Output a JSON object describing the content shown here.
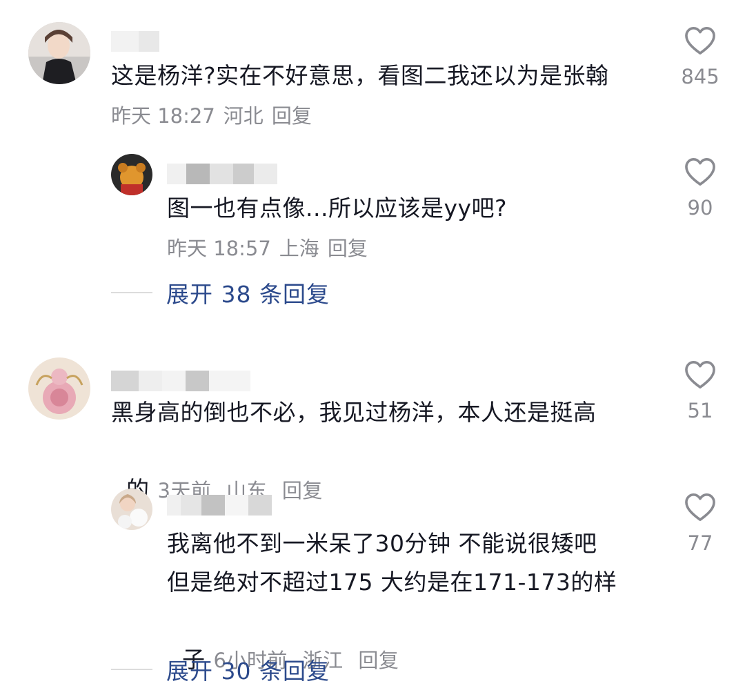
{
  "comments": [
    {
      "text": "这是杨洋?实在不好意思，看图二我还以为是张翰",
      "time": "昨天 18:27",
      "location": "河北",
      "reply": "回复",
      "likes": "845",
      "replies": [
        {
          "text": "图一也有点像...所以应该是yy吧?",
          "time": "昨天 18:57",
          "location": "上海",
          "reply": "回复",
          "likes": "90"
        }
      ],
      "expand_label": "展开 38 条回复"
    },
    {
      "text": "黑身高的倒也不必，我见过杨洋，本人还是挺高",
      "text_tail": "的",
      "time": "3天前",
      "location": "山东",
      "reply": "回复",
      "likes": "51",
      "replies": [
        {
          "text_line1": "我离他不到一米呆了30分钟 不能说很矮吧",
          "text_line2": "但是绝对不超过175 大约是在171-173的样",
          "text_tail": "子",
          "time": "6小时前",
          "location": "浙江",
          "reply": "回复",
          "likes": "77"
        }
      ],
      "expand_label": "展开 30 条回复"
    }
  ],
  "colors": {
    "text": "#161823",
    "meta": "#8a8b91",
    "link": "#2c4a8c",
    "heart": "#8a8b91"
  },
  "icons": [
    "heart-outline-icon"
  ]
}
